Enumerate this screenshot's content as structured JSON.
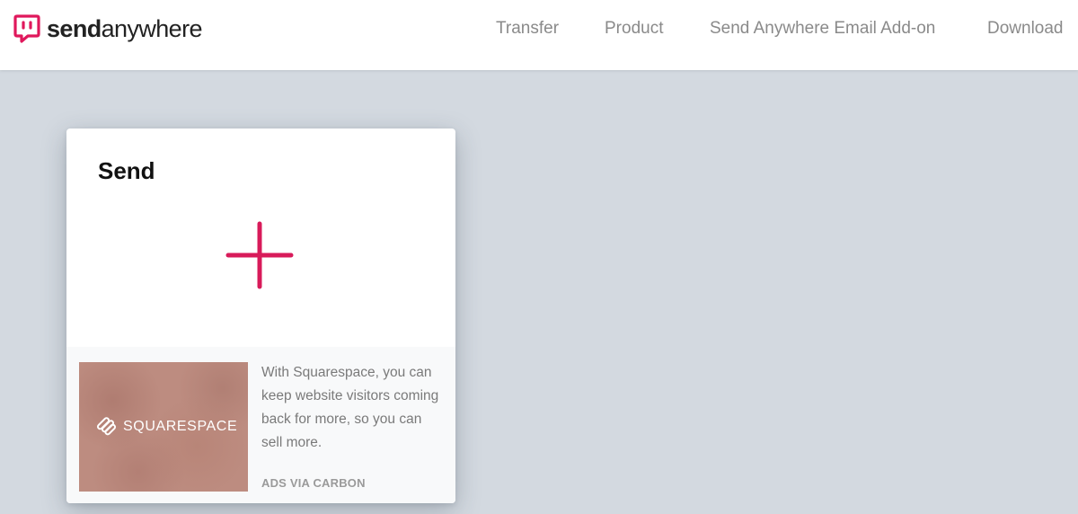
{
  "header": {
    "logo": {
      "part1": "send",
      "part2": "anywhere",
      "brand_color": "#e0185c",
      "icon": "sendanywhere-logo-icon"
    },
    "nav": [
      {
        "label": "Transfer"
      },
      {
        "label": "Product"
      },
      {
        "label": "Send Anywhere Email Add-on"
      },
      {
        "label": "Download"
      }
    ]
  },
  "send_card": {
    "title": "Send",
    "add_icon": "plus-icon",
    "add_icon_color": "#d81b5a"
  },
  "ad": {
    "brand": "SQUARESPACE",
    "brand_icon": "squarespace-logo-icon",
    "text": "With Squarespace, you can keep website visitors coming back for more, so you can sell more.",
    "via": "ADS VIA CARBON"
  },
  "colors": {
    "background": "#d3d9e0",
    "header_bg": "#ffffff",
    "nav_text": "#8a8a8a"
  }
}
